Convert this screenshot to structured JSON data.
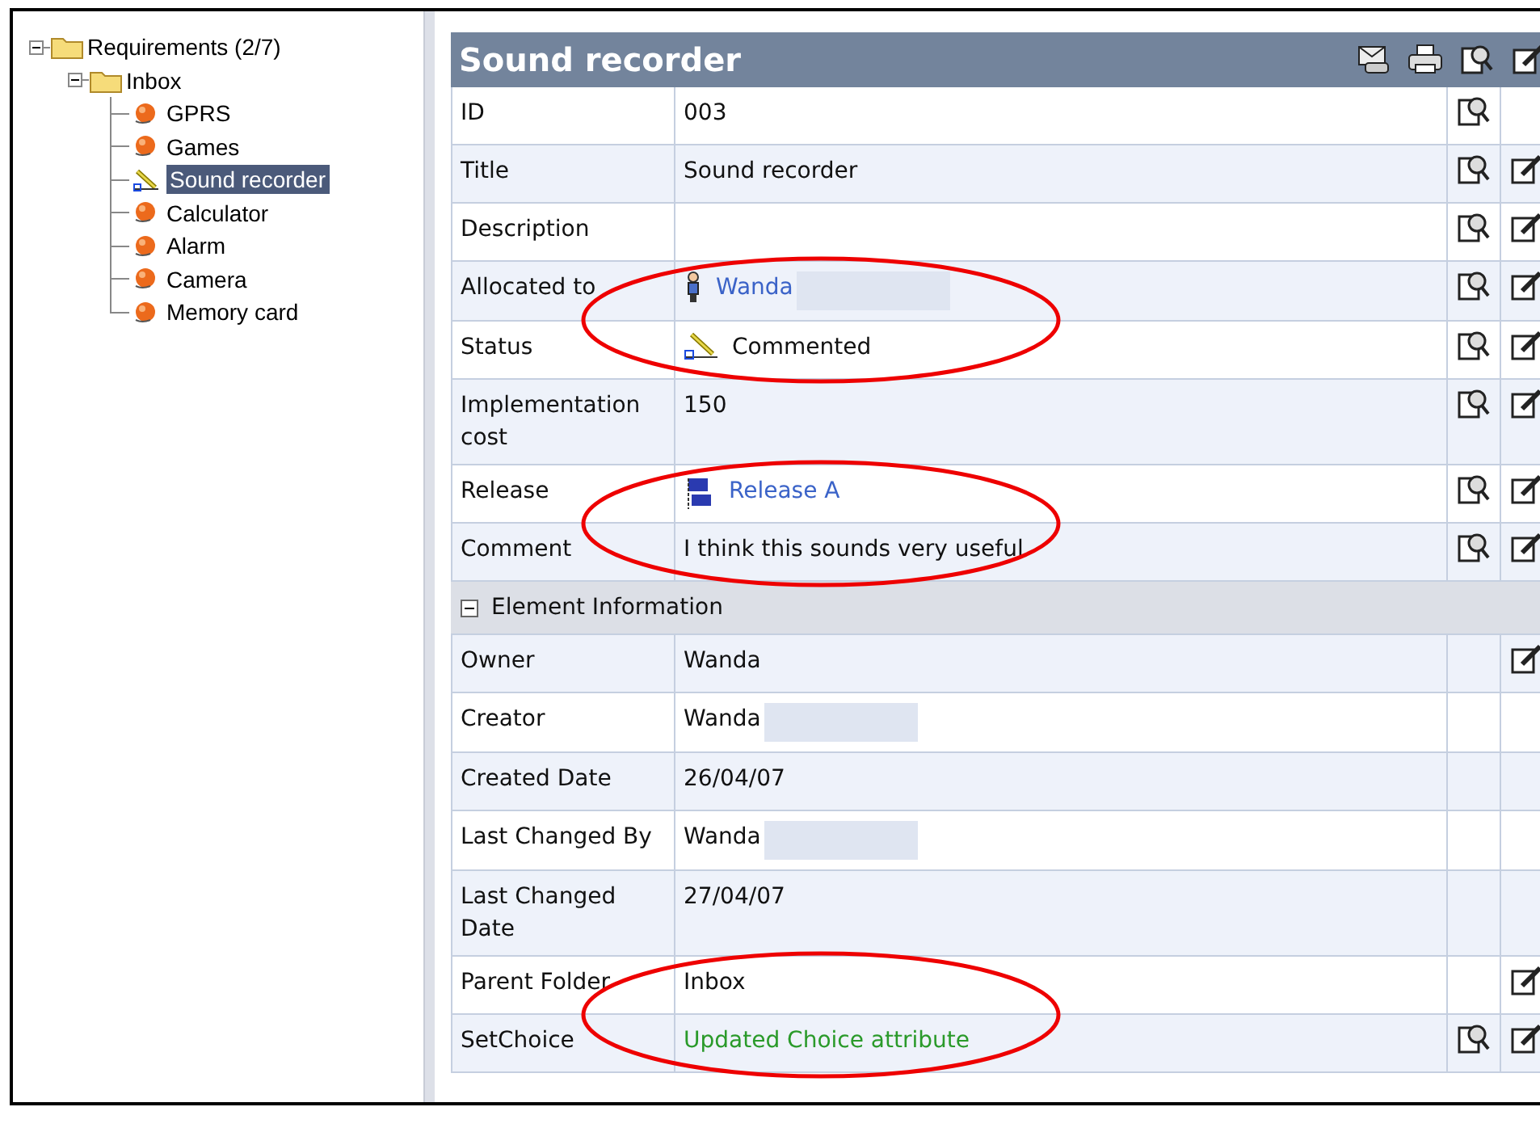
{
  "tree": {
    "label": "Requirements (2/7)",
    "kind": "folder",
    "expanded": true,
    "selected": false,
    "children": [
      {
        "label": "Inbox",
        "kind": "folder",
        "expanded": true,
        "selected": false,
        "children": [
          {
            "label": "GPRS",
            "kind": "item",
            "selected": false
          },
          {
            "label": "Games",
            "kind": "item",
            "selected": false
          },
          {
            "label": "Sound recorder",
            "kind": "commented",
            "selected": true
          },
          {
            "label": "Calculator",
            "kind": "item",
            "selected": false
          },
          {
            "label": "Alarm",
            "kind": "item",
            "selected": false
          },
          {
            "label": "Camera",
            "kind": "item",
            "selected": false
          },
          {
            "label": "Memory card",
            "kind": "item",
            "selected": false
          }
        ]
      }
    ]
  },
  "panel": {
    "title": "Sound recorder",
    "toolbar": [
      {
        "kind": "email"
      },
      {
        "kind": "print"
      },
      {
        "kind": "view"
      },
      {
        "kind": "edit"
      }
    ],
    "rows": [
      {
        "kind": "text",
        "label": "ID",
        "value": "003",
        "view": true,
        "edit": false
      },
      {
        "kind": "text",
        "label": "Title",
        "value": "Sound recorder",
        "view": true,
        "edit": true
      },
      {
        "kind": "text",
        "label": "Description",
        "view": true,
        "edit": true
      },
      {
        "kind": "person",
        "label": "Allocated to",
        "value": "Wanda",
        "redacted": true,
        "annotated": true,
        "view": true,
        "edit": true
      },
      {
        "kind": "status",
        "label": "Status",
        "value": "Commented",
        "view": true,
        "edit": true
      },
      {
        "kind": "text",
        "label": "Implementation cost",
        "value": "150",
        "view": true,
        "edit": true
      },
      {
        "kind": "release",
        "label": "Release",
        "value": "Release A",
        "annotated": true,
        "view": true,
        "edit": true
      },
      {
        "kind": "text",
        "label": "Comment",
        "value": "I think this sounds very useful",
        "view": true,
        "edit": true
      },
      {
        "kind": "section",
        "label": "Element Information",
        "expanded": true
      },
      {
        "kind": "text",
        "label": "Owner",
        "value": "Wanda",
        "view": false,
        "edit": true
      },
      {
        "kind": "text",
        "label": "Creator",
        "value": "Wanda",
        "redacted": true,
        "view": false,
        "edit": false
      },
      {
        "kind": "text",
        "label": "Created Date",
        "value": "26/04/07",
        "view": false,
        "edit": false
      },
      {
        "kind": "text",
        "label": "Last Changed By",
        "value": "Wanda",
        "redacted": true,
        "view": false,
        "edit": false
      },
      {
        "kind": "text",
        "label": "Last Changed Date",
        "value": "27/04/07",
        "view": false,
        "edit": false
      },
      {
        "kind": "text",
        "label": "Parent Folder",
        "value": "Inbox",
        "annotated": true,
        "view": false,
        "edit": true
      },
      {
        "kind": "highlight",
        "label": "SetChoice",
        "value": "Updated Choice attribute",
        "view": true,
        "edit": true
      }
    ]
  }
}
